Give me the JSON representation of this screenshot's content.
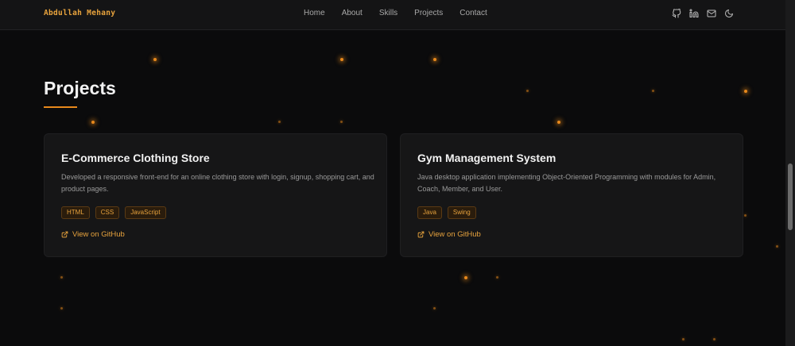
{
  "brand": "Abdullah Mehany",
  "nav": [
    "Home",
    "About",
    "Skills",
    "Projects",
    "Contact"
  ],
  "header_icons": [
    "github-icon",
    "linkedin-icon",
    "mail-icon",
    "moon-icon"
  ],
  "section_title": "Projects",
  "accent_color": "#e8891c",
  "projects": [
    {
      "title": "E-Commerce Clothing Store",
      "description": "Developed a responsive front-end for an online clothing store with login, signup, shopping cart, and product pages.",
      "tags": [
        "HTML",
        "CSS",
        "JavaScript"
      ],
      "link_label": "View on GitHub"
    },
    {
      "title": "Gym Management System",
      "description": "Java desktop application implementing Object-Oriented Programming with modules for Admin, Coach, Member, and User.",
      "tags": [
        "Java",
        "Swing"
      ],
      "link_label": "View on GitHub"
    }
  ]
}
